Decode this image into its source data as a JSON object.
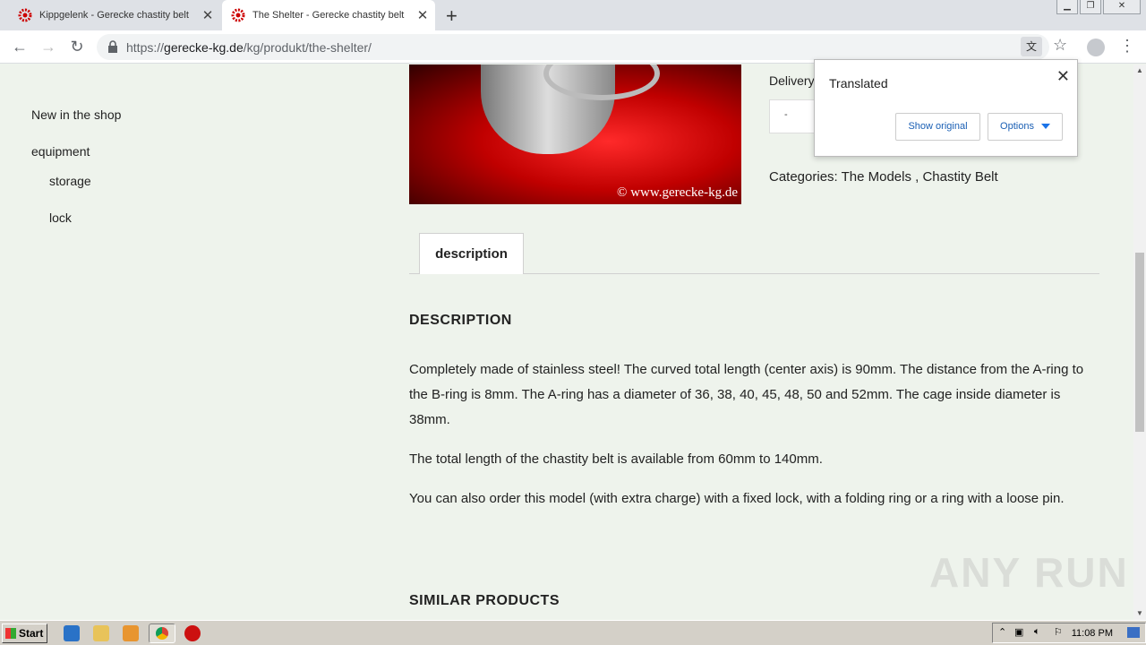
{
  "browser": {
    "tabs": [
      {
        "title": "Kippgelenk - Gerecke chastity belt",
        "active": false
      },
      {
        "title": "The Shelter - Gerecke chastity belt",
        "active": true
      }
    ],
    "url": {
      "prefix": "https://",
      "host": "gerecke-kg.de",
      "path": "/kg/produkt/the-shelter/"
    },
    "icons": {
      "back": "back-arrow-icon",
      "forward": "forward-arrow-icon",
      "reload": "reload-icon",
      "translate": "translate-icon",
      "star": "star-icon",
      "profile": "profile-icon",
      "menu": "kebab-menu-icon"
    }
  },
  "sidebar": {
    "items": [
      {
        "label": "New in the shop"
      },
      {
        "label": "equipment"
      },
      {
        "label": "storage"
      },
      {
        "label": "lock"
      }
    ]
  },
  "product": {
    "image_watermark": "© www.gerecke-kg.de",
    "delivery_label": "Delivery",
    "qty_value": "-",
    "categories_label": "Categories: The Models , Chastity Belt"
  },
  "content": {
    "tab_label": "description",
    "heading": "DESCRIPTION",
    "paragraphs": [
      "Completely made of stainless steel! The curved total length (center axis) is 90mm. The distance from the A-ring to the B-ring is 8mm. The A-ring has a diameter of 36, 38, 40, 45, 48, 50 and 52mm. The cage inside diameter is 38mm.",
      "The total length of the chastity belt is available from 60mm to 140mm.",
      "You can also order this model (with extra charge) with a fixed lock, with a folding ring or a ring with a loose pin."
    ],
    "similar_heading": "SIMILAR PRODUCTS"
  },
  "translate_popup": {
    "title": "Translated",
    "show_original": "Show original",
    "options": "Options"
  },
  "taskbar": {
    "start_label": "Start",
    "clock": "11:08 PM"
  },
  "watermark": "ANY RUN",
  "colors": {
    "page_bg": "#eef3ec",
    "link_blue": "#1a5fb4"
  }
}
